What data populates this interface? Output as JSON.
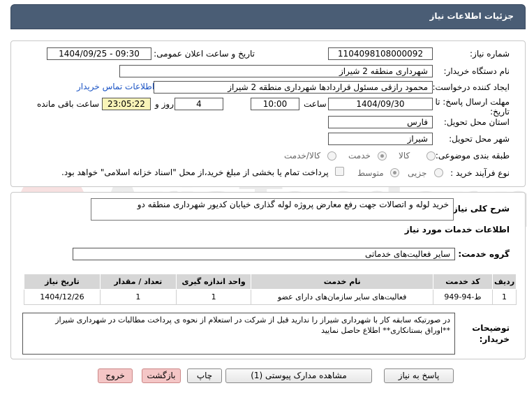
{
  "header": {
    "title": "جزئیات اطلاعات نیاز"
  },
  "form": {
    "need_number_label": "شماره نیاز:",
    "need_number": "1104098108000092",
    "announce_label": "تاریخ و ساعت اعلان عمومی:",
    "announce_value": "1404/09/25 - 09:30",
    "buyer_org_label": "نام دستگاه خریدار:",
    "buyer_org": "شهرداری منطقه 2 شیراز",
    "creator_label": "ایجاد کننده درخواست:",
    "creator": "محمود رازقی مسئول قراردادها شهرداری منطقه 2 شیراز",
    "contact_link": "اطلاعات تماس خریدار",
    "deadline_label_1": "مهلت ارسال پاسخ: تا",
    "deadline_label_2": "تاریخ:",
    "deadline_date": "1404/09/30",
    "time_label": "ساعت",
    "deadline_time": "10:00",
    "days_value": "4",
    "days_label": "روز و",
    "remaining_time": "23:05:22",
    "remaining_label": "ساعت باقی مانده",
    "province_label": "استان محل تحویل:",
    "province": "فارس",
    "city_label": "شهر محل تحویل:",
    "city": "شیراز",
    "category_label": "طبقه بندی موضوعی:",
    "category_options": [
      "کالا",
      "خدمت",
      "کالا/خدمت"
    ],
    "process_label": "نوع فرآیند خرید :",
    "process_options": [
      "جزیی",
      "متوسط"
    ],
    "payment_note": "پرداخت تمام یا بخشی از مبلغ خرید،از محل \"اسناد خزانه اسلامی\" خواهد بود."
  },
  "summary": {
    "label": "شرح کلی نیاز:",
    "value": "خرید لوله و اتصالات جهت رفع معارض پروژه لوله گذاری خیابان کدیور شهرداری منطقه دو"
  },
  "services": {
    "section_title": "اطلاعات خدمات مورد نیاز",
    "group_label": "گروه خدمت:",
    "group_value": "سایر فعالیت‌های خدماتی",
    "columns": [
      "ردیف",
      "کد خدمت",
      "نام خدمت",
      "واحد اندازه گیری",
      "تعداد / مقدار",
      "تاریخ نیاز"
    ],
    "rows": [
      [
        "1",
        "ط-94-949",
        "فعالیت‌های سایر سازمان‌های دارای عضو",
        "1",
        "1",
        "1404/12/26"
      ]
    ]
  },
  "buyer_notes": {
    "label_1": "توضیحات",
    "label_2": "خریدار:",
    "line_1": "در صورتیکه سابقه کار با شهرداری شیراز را ندارید قبل از شرکت در استعلام از نحوه ی پرداخت مطالبات در شهرداری شیراز",
    "line_2": "**اوراق بستانکاری** اطلاع حاصل نمایید"
  },
  "buttons": {
    "reply": "پاسخ به نیاز",
    "attachments": "مشاهده مدارک پیوستی (1)",
    "print": "چاپ",
    "back": "بازگشت",
    "exit": "خروج"
  },
  "watermark": "AriaTender.net"
}
